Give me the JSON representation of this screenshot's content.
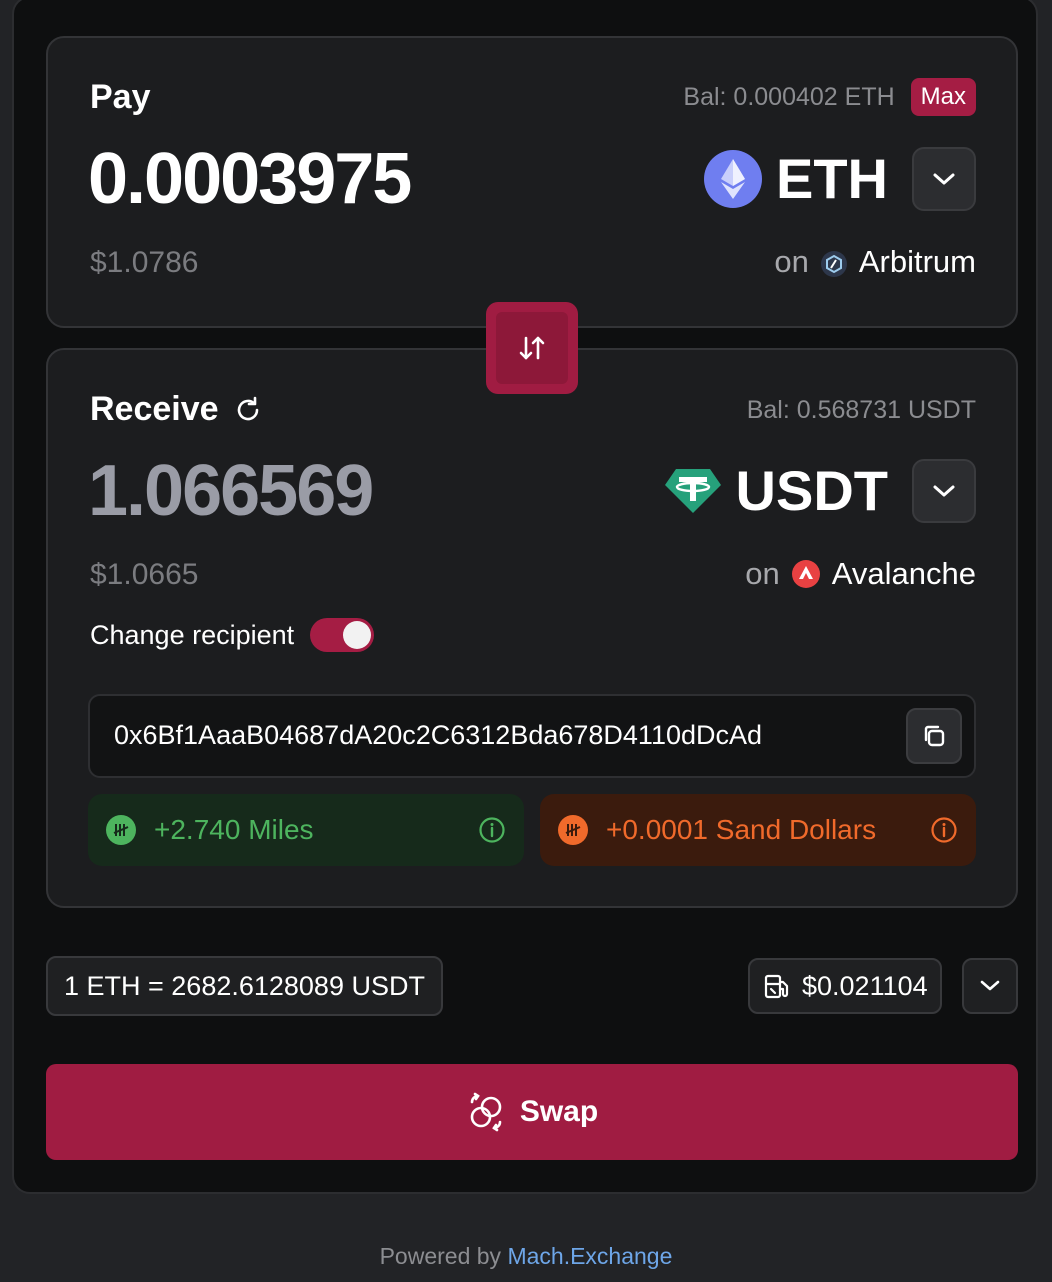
{
  "pay": {
    "label": "Pay",
    "balance": "Bal: 0.000402 ETH",
    "max_label": "Max",
    "amount": "0.0003975",
    "usd_value": "$1.0786",
    "token": "ETH",
    "on_label": "on",
    "network": "Arbitrum"
  },
  "receive": {
    "label": "Receive",
    "balance": "Bal: 0.568731 USDT",
    "amount": "1.066569",
    "usd_value": "$1.0665",
    "token": "USDT",
    "on_label": "on",
    "network": "Avalanche",
    "change_recipient_label": "Change recipient",
    "change_recipient_enabled": true,
    "recipient_address": "0x6Bf1AaaB04687dA20c2C6312Bda678D4110dDcAd"
  },
  "rewards": {
    "miles": "+2.740 Miles",
    "sand_dollars": "+0.0001 Sand Dollars"
  },
  "rate": "1 ETH = 2682.6128089 USDT",
  "gas_fee": "$0.021104",
  "swap_label": "Swap",
  "footer": {
    "prefix": "Powered by",
    "link": "Mach.Exchange"
  },
  "colors": {
    "accent": "#a01c42",
    "miles": "#4db45e",
    "sand": "#f06a2b",
    "link": "#6ea6e8"
  }
}
